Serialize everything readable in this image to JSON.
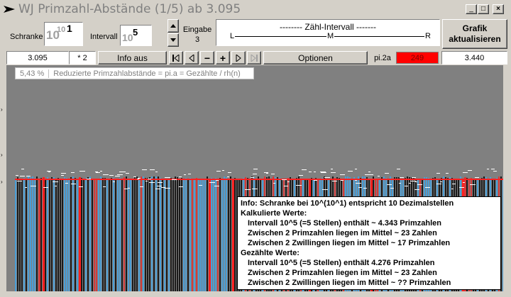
{
  "window": {
    "title": "WJ Primzahl-Abstände (1/5) ab 3.095",
    "min_label": "_",
    "max_label": "□",
    "close_label": "×"
  },
  "controls": {
    "schranke_label": "Schranke",
    "schranke_base": "10",
    "schranke_base2": "10",
    "schranke_exp": "1",
    "intervall_label": "Intervall",
    "intervall_base": "10",
    "intervall_exp": "5",
    "eingabe_label": "Eingabe",
    "eingabe_value": "3",
    "zaehl_title": "-------- Zähl-Intervall -------",
    "zaehl_l": "L",
    "zaehl_m": "M",
    "zaehl_r": "R",
    "grafik_button": "Grafik aktualisieren",
    "start_value": "3.095",
    "factor_value": "* 2",
    "info_button": "Info aus",
    "nav_first": "|◁",
    "nav_prev": "◁",
    "nav_minus": "−",
    "nav_plus": "+",
    "nav_next": "▷",
    "nav_last": "▷|",
    "optionen_button": "Optionen",
    "pi_label": "pi.2a",
    "pi_value": "249",
    "pi_color": "#ff0000",
    "end_value": "3.440"
  },
  "plot": {
    "percent": "5,43 %",
    "caption": "Reduzierte Primzahlabstände = pi.a = Gezählte / rh(n)",
    "bar_colors": [
      "#1a1a1a",
      "#4a9ed6",
      "#d23a3a",
      "#ff2020"
    ]
  },
  "info": {
    "line1": "Info:  Schranke bei 10^(10^1) entspricht 10 Dezimalstellen",
    "line2": "Kalkulierte Werte:",
    "line3": "Intervall 10^5 (=5 Stellen) enthält ~ 4.343 Primzahlen",
    "line4": "Zwischen 2 Primzahlen liegen im Mittel ~ 23 Zahlen",
    "line5": "Zwischen 2 Zwillingen liegen im Mittel ~ 17 Primzahlen",
    "line6": "Gezählte Werte:",
    "line7": "Intervall 10^5 (=5 Stellen) enthält 4.276 Primzahlen",
    "line8": "Zwischen 2 Primzahlen liegen im Mittel ~ 23 Zahlen",
    "line9": "Zwischen 2 Zwillingen liegen im Mittel ~ ?? Primzahlen"
  }
}
